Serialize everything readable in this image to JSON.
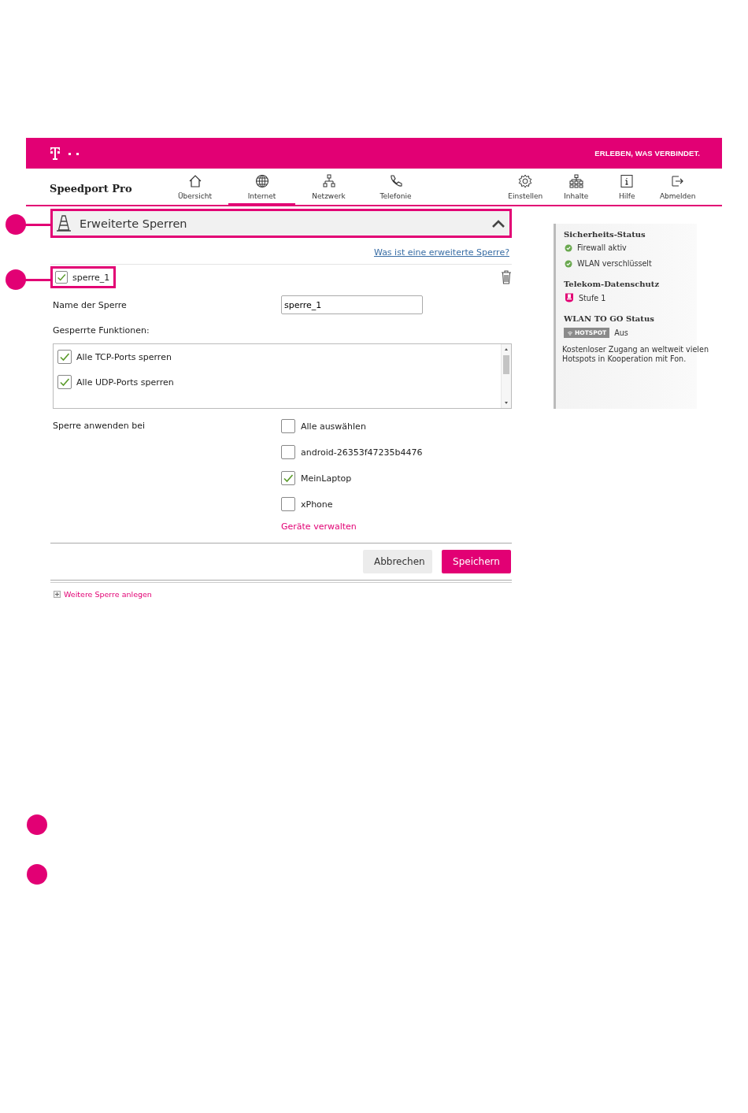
{
  "header": {
    "tagline": "ERLEBEN, WAS VERBINDET."
  },
  "product": "Speedport Pro",
  "nav_main": [
    {
      "label": "Übersicht",
      "selected": false
    },
    {
      "label": "Internet",
      "selected": true
    },
    {
      "label": "Netzwerk",
      "selected": false
    },
    {
      "label": "Telefonie",
      "selected": false
    }
  ],
  "nav_utility": [
    {
      "label": "Einstellen"
    },
    {
      "label": "Inhalte"
    },
    {
      "label": "Hilfe"
    },
    {
      "label": "Abmelden"
    }
  ],
  "section": {
    "title": "Erweiterte Sperren",
    "expanded": true,
    "help_link": "Was ist eine erweiterte Sperre?"
  },
  "rule": {
    "name": "sperre_1",
    "enabled": true,
    "name_label": "Name der Sperre",
    "name_value": "sperre_1",
    "functions_label": "Gesperrte Funktionen:",
    "functions": [
      {
        "label": "Alle TCP-Ports sperren",
        "checked": true
      },
      {
        "label": "Alle UDP-Ports sperren",
        "checked": true
      }
    ],
    "apply_label": "Sperre anwenden bei",
    "devices": [
      {
        "label": "Alle auswählen",
        "checked": false
      },
      {
        "label": "android-26353f47235b4476",
        "checked": false
      },
      {
        "label": "MeinLaptop",
        "checked": true
      },
      {
        "label": "xPhone",
        "checked": false
      }
    ],
    "manage_link": "Geräte verwalten"
  },
  "buttons": [
    {
      "label": "Abbrechen",
      "kind": "secondary"
    },
    {
      "label": "Speichern",
      "kind": "primary"
    }
  ],
  "add_link": "Weitere Sperre anlegen",
  "sidebar": {
    "security_title": "Sicherheits-Status",
    "security_items": [
      {
        "label": "Firewall aktiv",
        "ok": true
      },
      {
        "label": "WLAN verschlüsselt",
        "ok": true
      }
    ],
    "privacy_title": "Telekom-Datenschutz",
    "privacy_level": "Stufe 1",
    "wlan_title": "WLAN TO GO Status",
    "hotspot_badge": "HOTSPOT",
    "hotspot_status": "Aus",
    "wlan_text": "Kostenloser Zugang an weltweit vielen Hotspots in Kooperation mit Fon."
  }
}
